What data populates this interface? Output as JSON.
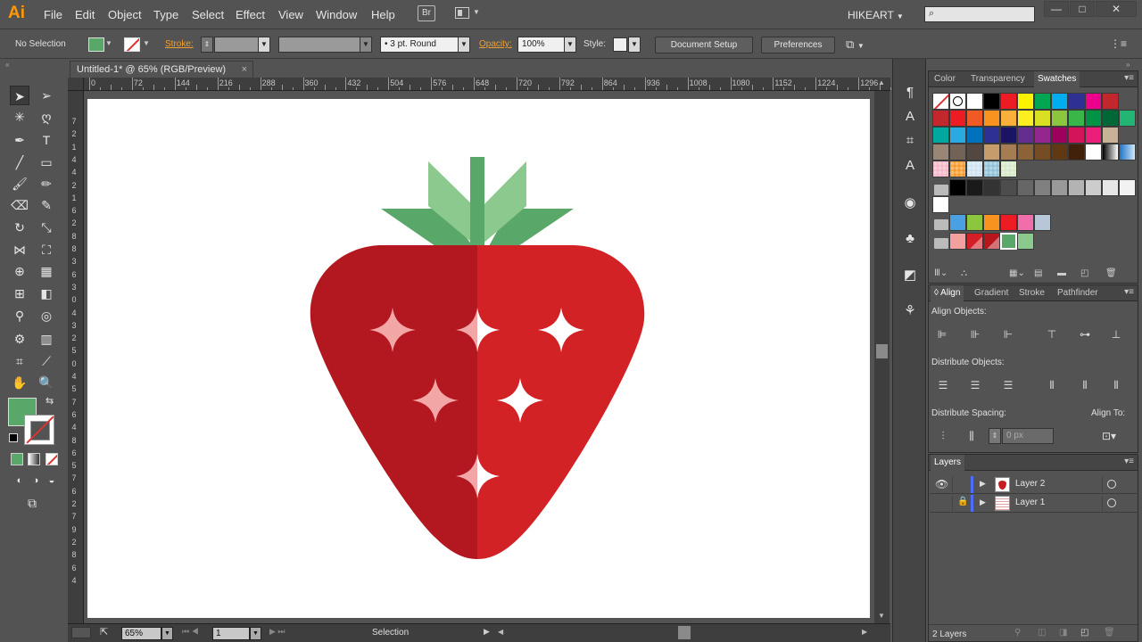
{
  "app": {
    "logo": "Ai",
    "user": "HIKEART",
    "bridge_label": "Br"
  },
  "menu": [
    "File",
    "Edit",
    "Object",
    "Type",
    "Select",
    "Effect",
    "View",
    "Window",
    "Help"
  ],
  "window_controls": [
    "—",
    "□",
    "✕"
  ],
  "control_bar": {
    "selection_state": "No Selection",
    "stroke_label": "Stroke:",
    "brush": "3 pt. Round",
    "opacity_label": "Opacity:",
    "opacity_value": "100%",
    "style_label": "Style:",
    "document_setup": "Document Setup",
    "preferences": "Preferences"
  },
  "document": {
    "tab_title": "Untitled-1* @ 65% (RGB/Preview)",
    "close": "×"
  },
  "ruler_top": [
    "0",
    "72",
    "144",
    "216",
    "288",
    "360",
    "432",
    "504",
    "576",
    "648",
    "720",
    "792",
    "864",
    "936",
    "1008",
    "1080",
    "1152",
    "1224",
    "1296"
  ],
  "ruler_left": [
    "7",
    "2",
    "1",
    "4",
    "4",
    "2",
    "1",
    "6",
    "2",
    "8",
    "8",
    "3",
    "6",
    "3",
    "0",
    "4",
    "3",
    "2",
    "5",
    "0",
    "4",
    "5",
    "7",
    "6",
    "4",
    "8",
    "6",
    "5",
    "7",
    "6",
    "2",
    "7",
    "9",
    "2",
    "8",
    "6",
    "4"
  ],
  "status": {
    "zoom": "65%",
    "page": "1",
    "tool": "Selection"
  },
  "swatch_panel": {
    "tabs": [
      "Color",
      "Transparency",
      "Swatches"
    ],
    "active": "Swatches",
    "colors": {
      "row1": [
        "#ffffff",
        "#000000",
        "#ed1c24",
        "#fff200",
        "#00a651",
        "#00aeef",
        "#2e3192",
        "#ec008c",
        "#c1272d"
      ],
      "row2": [
        "#c1272d",
        "#ed1c24",
        "#f15a24",
        "#f7931e",
        "#fbb03b",
        "#fcee21",
        "#d9e021",
        "#8cc63f",
        "#39b54a",
        "#009245",
        "#006837",
        "#22b573"
      ],
      "row3": [
        "#00a99d",
        "#29abe2",
        "#0071bc",
        "#2e3192",
        "#1b1464",
        "#662d91",
        "#93278f",
        "#9e005d",
        "#d4145a",
        "#ed1e79",
        "#c7b299"
      ],
      "row4": [
        "#998675",
        "#736357",
        "#534741",
        "#c69c6d",
        "#a67c52",
        "#8c6239",
        "#754c24",
        "#603813",
        "#42210b",
        "#ffffff",
        "#4aa0e0"
      ],
      "gray": [
        "#000000",
        "#1a1a1a",
        "#333333",
        "#4d4d4d",
        "#666666",
        "#808080",
        "#999999",
        "#b3b3b3",
        "#cccccc",
        "#e6e6e6",
        "#f2f2f2"
      ],
      "group1": [
        "#4aa0e0",
        "#8cc63f",
        "#f7931e",
        "#ed1c24",
        "#f06ea9",
        "#b7c7d7"
      ],
      "group2": [
        "#f4a0a0",
        "#d41f26",
        "#b7161d",
        "#5aa76a",
        "#8cc98c"
      ]
    }
  },
  "align_panel": {
    "tabs": [
      "Align",
      "Gradient",
      "Stroke",
      "Pathfinder"
    ],
    "active": "Align",
    "align_objects": "Align Objects:",
    "distribute_objects": "Distribute Objects:",
    "distribute_spacing": "Distribute Spacing:",
    "align_to": "Align To:",
    "spacing_value": "0 px"
  },
  "layers_panel": {
    "title": "Layers",
    "layers": [
      {
        "name": "Layer 2",
        "color": "#4b6eff"
      },
      {
        "name": "Layer 1",
        "color": "#4b6eff"
      }
    ],
    "count": "2 Layers"
  },
  "artwork": {
    "left_half": "#b3171f",
    "right_half": "#d22226",
    "leaf_dark": "#5aa76a",
    "leaf_light": "#8cc98e",
    "sparkle_left": "#f2a6a6",
    "sparkle_right": "#ffffff"
  }
}
